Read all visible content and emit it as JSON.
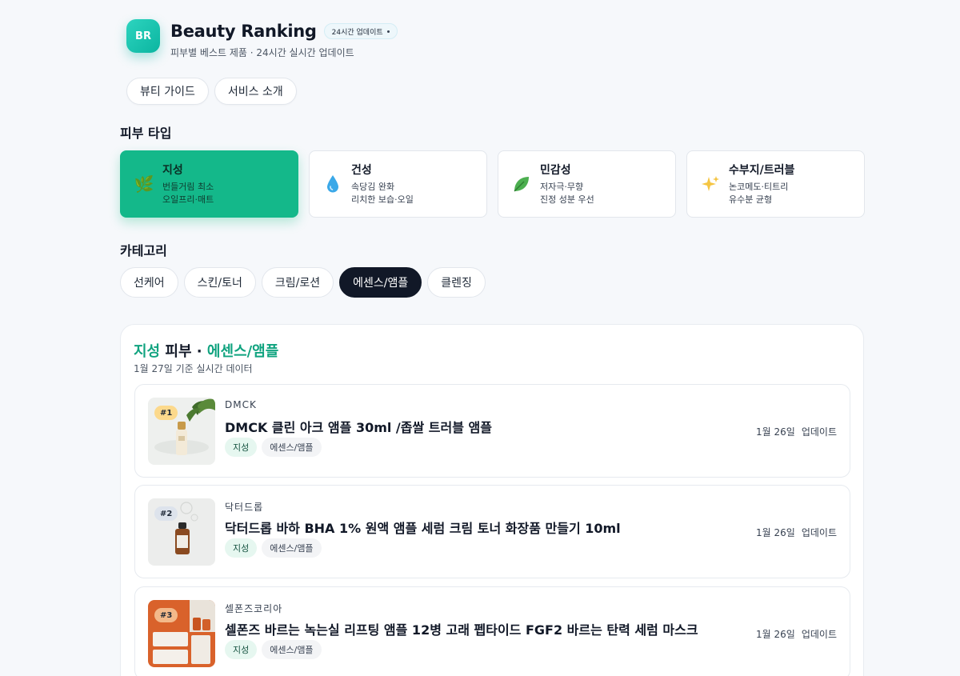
{
  "header": {
    "logo": "BR",
    "title": "Beauty Ranking",
    "badge": "24시간 업데이트",
    "subtitle": "피부별 베스트 제품 · 24시간 실시간 업데이트"
  },
  "topnav": [
    {
      "label": "뷰티 가이드"
    },
    {
      "label": "서비스 소개"
    }
  ],
  "skin_section": {
    "title": "피부 타입",
    "types": [
      {
        "name": "지성",
        "desc1": "번들거림 최소",
        "desc2": "오일프리·매트",
        "icon": "herb-icon",
        "active": true
      },
      {
        "name": "건성",
        "desc1": "속당김 완화",
        "desc2": "리치한 보습·오일",
        "icon": "droplet-icon",
        "active": false
      },
      {
        "name": "민감성",
        "desc1": "저자극·무향",
        "desc2": "진정 성분 우선",
        "icon": "leaf-icon",
        "active": false
      },
      {
        "name": "수부지/트러블",
        "desc1": "논코메도·티트리",
        "desc2": "유수분 균형",
        "icon": "sparkles-icon",
        "active": false
      }
    ]
  },
  "category_section": {
    "title": "카테고리",
    "items": [
      {
        "label": "선케어"
      },
      {
        "label": "스킨/토너"
      },
      {
        "label": "크림/로션"
      },
      {
        "label": "에센스/앰플"
      },
      {
        "label": "클렌징"
      }
    ],
    "selected": "에센스/앰플"
  },
  "results": {
    "skin": "지성",
    "mid": "피부 ·",
    "category": "에센스/앰플",
    "date_note": "1월 27일 기준 실시간 데이터",
    "products": [
      {
        "rank": "#1",
        "brand": "DMCK",
        "name": "DMCK 클린 아크 앰플 30ml /좁쌀 트러블 앰플",
        "skin_tag": "지성",
        "cat_tag": "에센스/앰플",
        "date": "1월 26일",
        "update": "업데이트"
      },
      {
        "rank": "#2",
        "brand": "닥터드롭",
        "name": "닥터드롭 바하 BHA 1% 원액 앰플 세럼 크림 토너 화장품 만들기 10ml",
        "skin_tag": "지성",
        "cat_tag": "에센스/앰플",
        "date": "1월 26일",
        "update": "업데이트"
      },
      {
        "rank": "#3",
        "brand": "셀폰즈코리아",
        "name": "셀폰즈 바르는 녹는실 리프팅 앰플 12병 고래 펩타이드 FGF2 바르는 탄력 세럼 마스크",
        "skin_tag": "지성",
        "cat_tag": "에센스/앰플",
        "date": "1월 26일",
        "update": "업데이트"
      }
    ]
  },
  "colors": {
    "accent": "#14b88a",
    "accent_text": "#10a37f",
    "chip_active": "#111827"
  }
}
